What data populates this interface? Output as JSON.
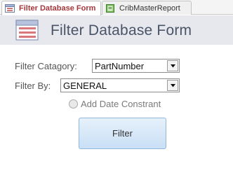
{
  "tabs": [
    {
      "label": "Filter Database Form",
      "icon": "form-icon",
      "active": true
    },
    {
      "label": "CribMasterReport",
      "icon": "report-icon",
      "active": false
    }
  ],
  "header": {
    "title": "Filter Database Form",
    "icon": "form-icon"
  },
  "fields": {
    "category": {
      "label": "Filter Catagory:",
      "value": "PartNumber"
    },
    "filter_by": {
      "label": "Filter By:",
      "value": "GENERAL"
    }
  },
  "date_constraint": {
    "label": "Add Date Constrant",
    "selected": false
  },
  "filter_button": {
    "label": "Filter"
  },
  "colors": {
    "accent": "#a5373b",
    "header_bg": "#e6e8ee",
    "button_bg": "#c9dff5"
  }
}
